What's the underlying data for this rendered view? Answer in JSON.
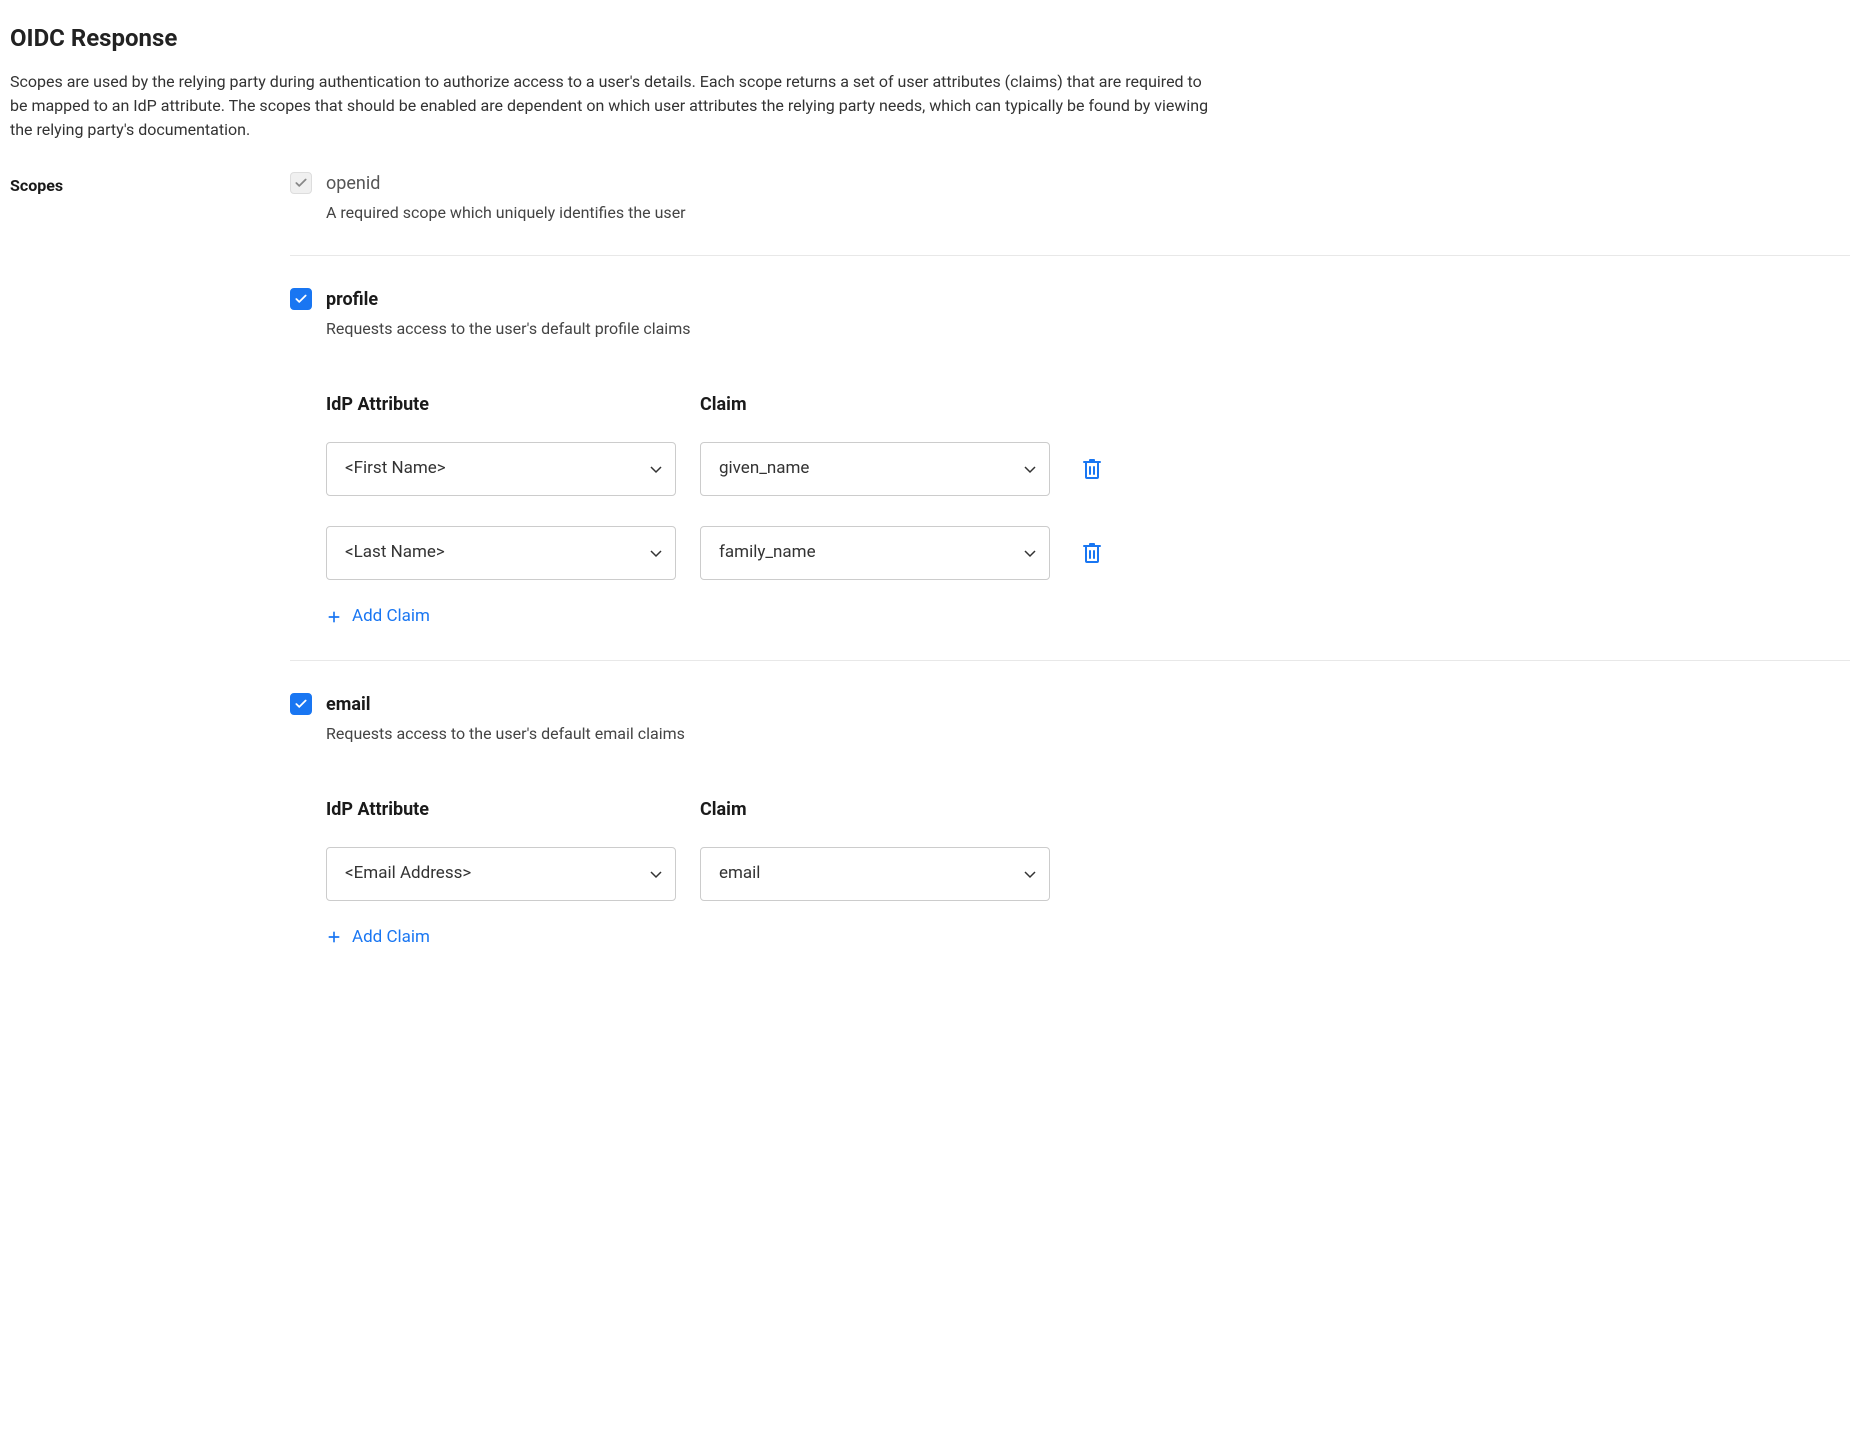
{
  "title": "OIDC Response",
  "description": "Scopes are used by the relying party during authentication to authorize access to a user's details. Each scope returns a set of user attributes (claims) that are required to be mapped to an IdP attribute. The scopes that should be enabled are dependent on which user attributes the relying party needs, which can typically be found by viewing the relying party's documentation.",
  "scopesLabel": "Scopes",
  "columnHeaders": {
    "idp": "IdP Attribute",
    "claim": "Claim"
  },
  "addClaimLabel": "Add Claim",
  "scopes": {
    "openid": {
      "name": "openid",
      "desc": "A required scope which uniquely identifies the user",
      "checked": true,
      "disabled": true
    },
    "profile": {
      "name": "profile",
      "desc": "Requests access to the user's default profile claims",
      "checked": true,
      "disabled": false,
      "claims": [
        {
          "idp": "<First Name>",
          "claim": "given_name"
        },
        {
          "idp": "<Last Name>",
          "claim": "family_name"
        }
      ]
    },
    "email": {
      "name": "email",
      "desc": "Requests access to the user's default email claims",
      "checked": true,
      "disabled": false,
      "claims": [
        {
          "idp": "<Email Address>",
          "claim": "email"
        }
      ]
    }
  }
}
